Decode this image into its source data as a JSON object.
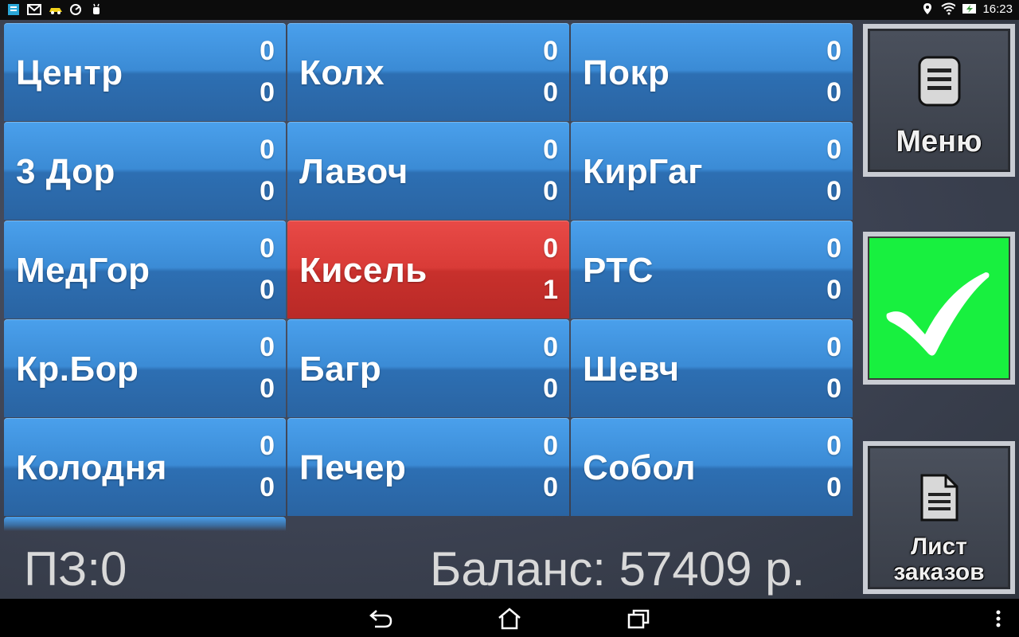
{
  "statusbar": {
    "time": "16:23"
  },
  "tiles": [
    {
      "name": "Центр",
      "top": "0",
      "bottom": "0",
      "active": false
    },
    {
      "name": "Колх",
      "top": "0",
      "bottom": "0",
      "active": false
    },
    {
      "name": "Покр",
      "top": "0",
      "bottom": "0",
      "active": false
    },
    {
      "name": "3 Дор",
      "top": "0",
      "bottom": "0",
      "active": false
    },
    {
      "name": "Лавоч",
      "top": "0",
      "bottom": "0",
      "active": false
    },
    {
      "name": "КирГаг",
      "top": "0",
      "bottom": "0",
      "active": false
    },
    {
      "name": "МедГор",
      "top": "0",
      "bottom": "0",
      "active": false
    },
    {
      "name": "Кисель",
      "top": "0",
      "bottom": "1",
      "active": true
    },
    {
      "name": "РТС",
      "top": "0",
      "bottom": "0",
      "active": false
    },
    {
      "name": "Кр.Бор",
      "top": "0",
      "bottom": "0",
      "active": false
    },
    {
      "name": "Багр",
      "top": "0",
      "bottom": "0",
      "active": false
    },
    {
      "name": "Шевч",
      "top": "0",
      "bottom": "0",
      "active": false
    },
    {
      "name": "Колодня",
      "top": "0",
      "bottom": "0",
      "active": false
    },
    {
      "name": "Печер",
      "top": "0",
      "bottom": "0",
      "active": false
    },
    {
      "name": "Собол",
      "top": "0",
      "bottom": "0",
      "active": false
    }
  ],
  "footer": {
    "pz": "ПЗ:0",
    "balance": "Баланс: 57409 р."
  },
  "side": {
    "menu_label": "Меню",
    "orders_label_1": "Лист",
    "orders_label_2": "заказов"
  },
  "colors": {
    "tile_blue": "#3b8bd5",
    "tile_active": "#d93b37",
    "ok_green": "#18f03f"
  }
}
